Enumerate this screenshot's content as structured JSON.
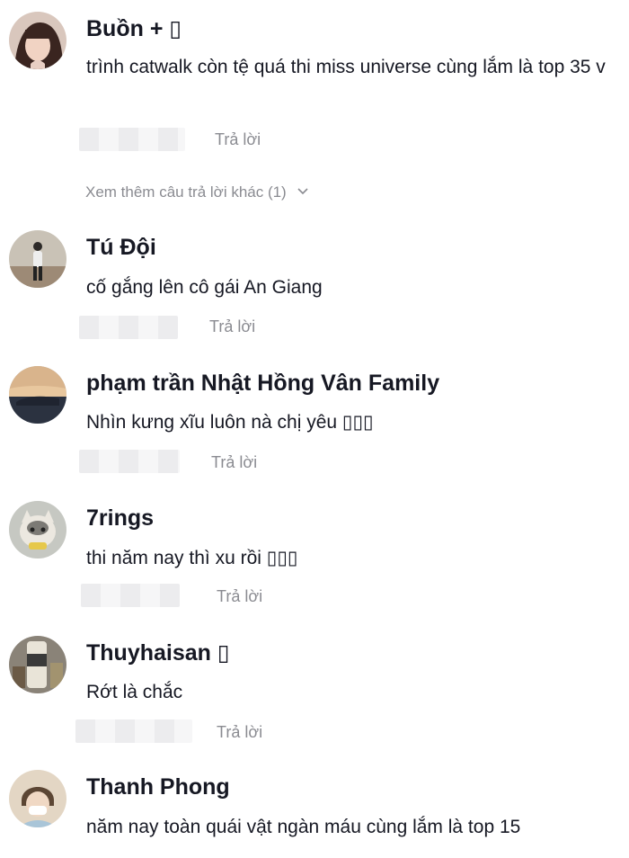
{
  "comments": [
    {
      "username": "Buồn + ▯",
      "text": "trình catwalk còn tệ quá thi miss universe cùng lắm là top 35 v",
      "reply": "Trả lời"
    },
    {
      "username": "Tú Đội",
      "text": "cố gắng lên cô gái An Giang",
      "reply": "Trả lời"
    },
    {
      "username": "phạm trần Nhật Hồng Vân Family",
      "text": "Nhìn kưng xĩu luôn nà chị yêu ▯▯▯",
      "reply": "Trả lời"
    },
    {
      "username": "7rings",
      "text": "thi năm nay thì xu rồi ▯▯▯",
      "reply": "Trả lời"
    },
    {
      "username": "Thuyhaisan ▯",
      "text": "Rớt là chắc",
      "reply": "Trả lời"
    },
    {
      "username": "Thanh Phong",
      "text": "năm nay toàn quái vật ngàn máu cùng lắm là top 15",
      "reply": ""
    }
  ],
  "more_replies": "Xem thêm câu trả lời khác (1)",
  "icons": {
    "more_chevron": "chevron-down-icon"
  },
  "colors": {
    "username": "#161823",
    "secondary": "#8a8b91"
  }
}
